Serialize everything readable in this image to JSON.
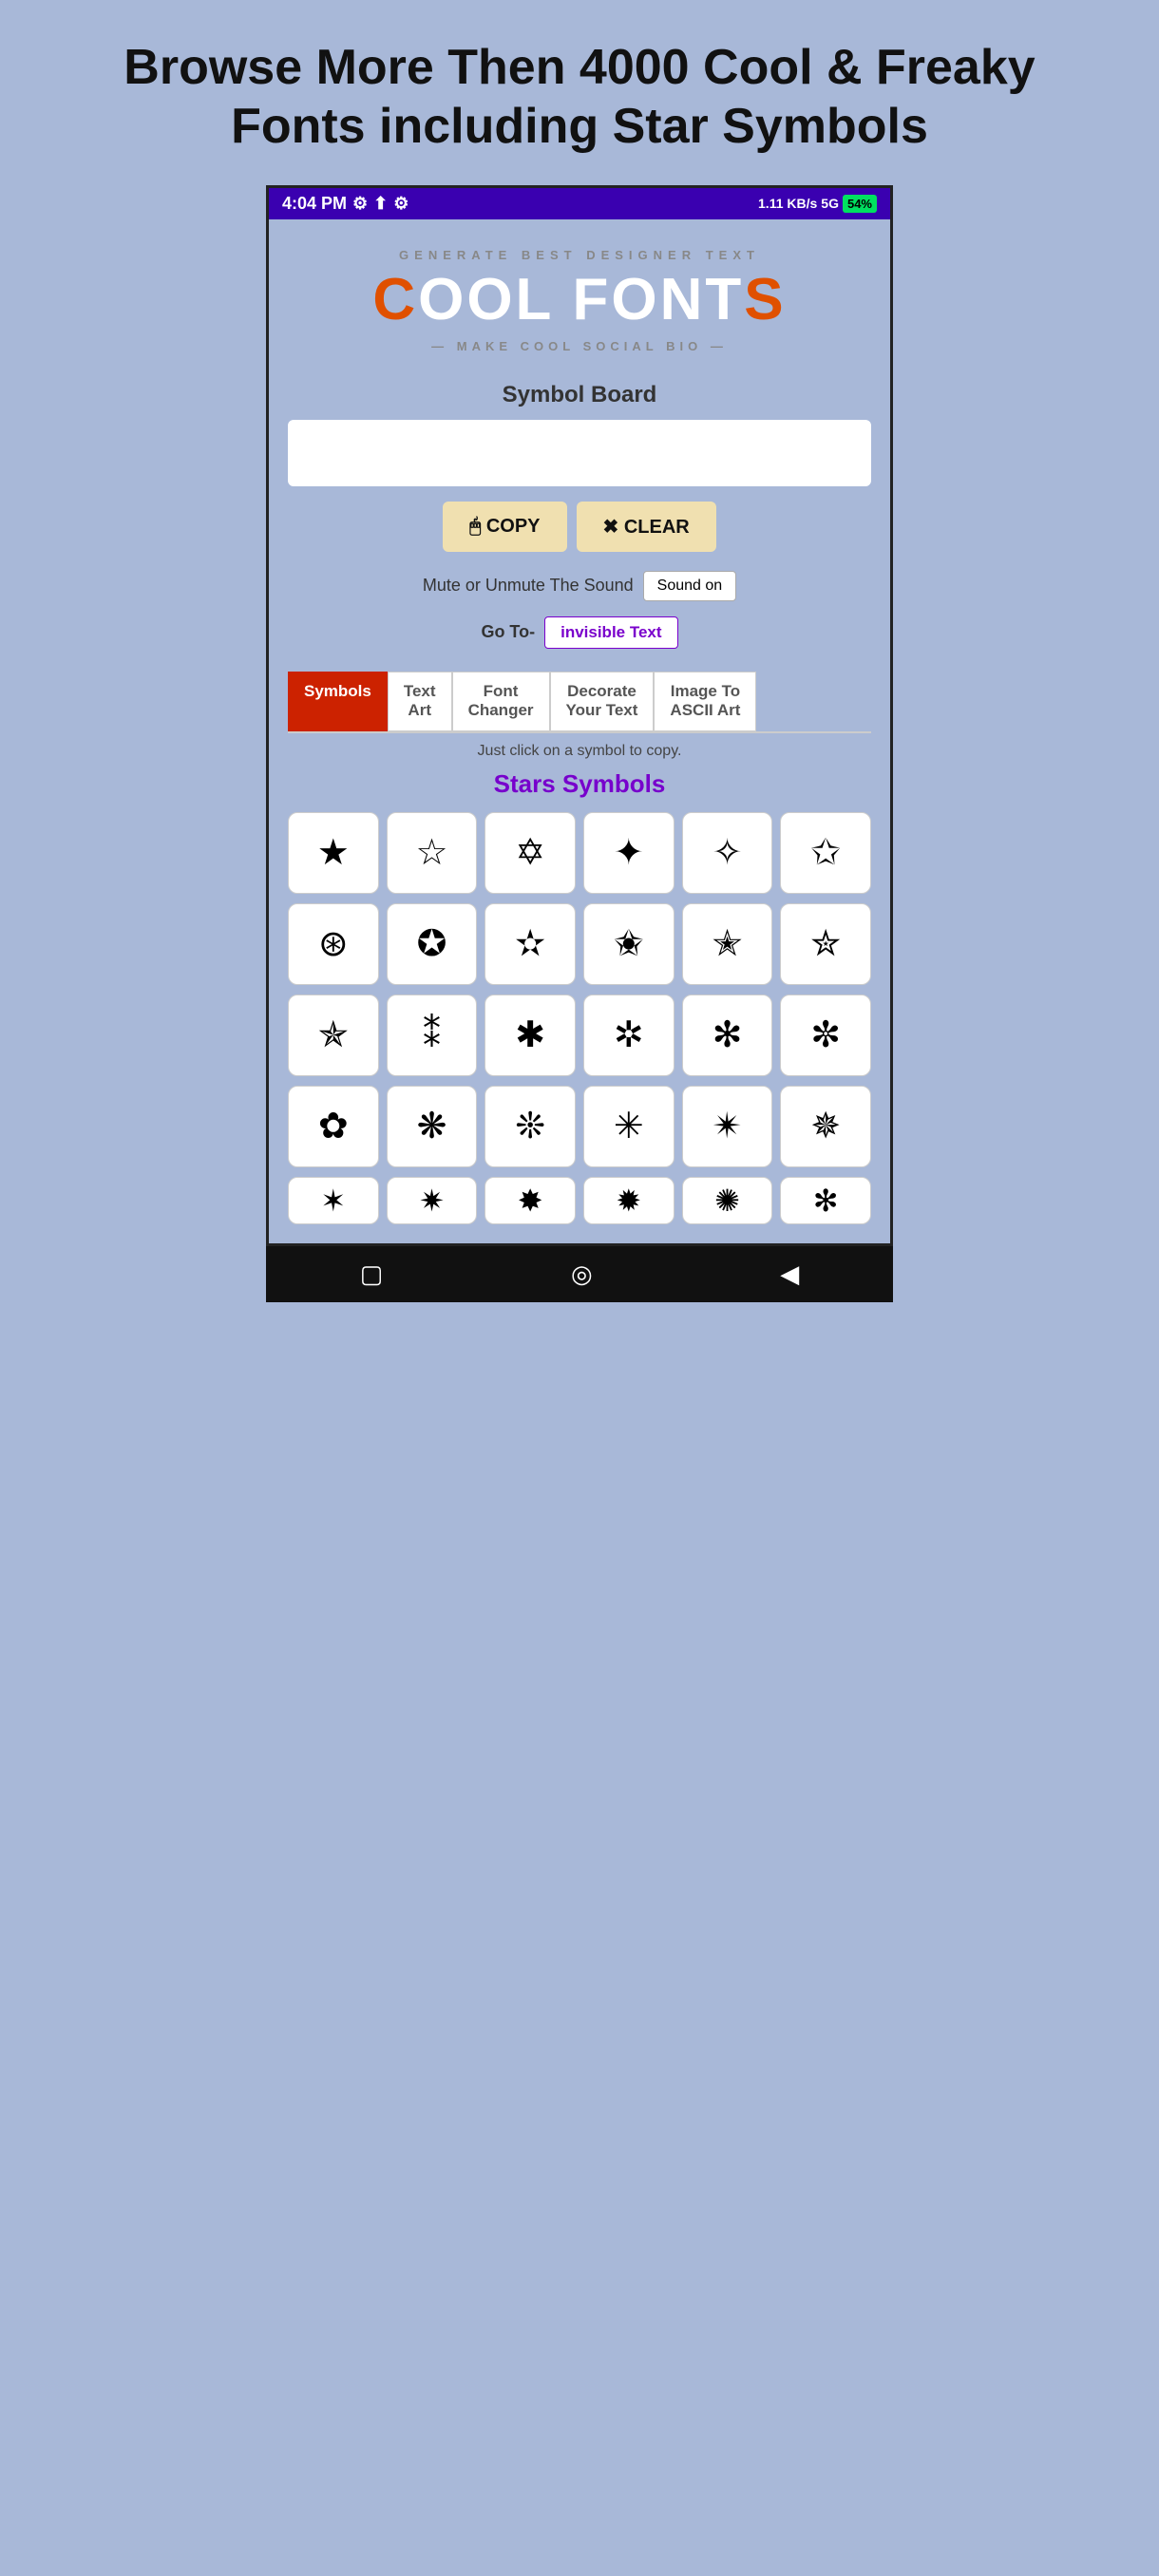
{
  "header": {
    "title": "Browse More Then 4000 Cool & Freaky Fonts including Star Symbols"
  },
  "statusBar": {
    "time": "4:04 PM",
    "network": "1.11 KB/s",
    "battery": "54%"
  },
  "appBanner": {
    "subtitle": "GENERATE BEST DESIGNER TEXT",
    "mainTitle": "COOL FONTS",
    "tagline": "— MAKE COOL SOCIAL BIO —"
  },
  "symbolBoard": {
    "sectionTitle": "Symbol Board",
    "inputPlaceholder": "",
    "copyBtn": "🖱 COPY",
    "clearBtn": "✖ CLEAR"
  },
  "sound": {
    "label": "Mute or Unmute The Sound",
    "btn": "Sound on"
  },
  "goto": {
    "label": "Go To-",
    "btn": "invisible Text"
  },
  "tabs": [
    {
      "id": "symbols",
      "label": "Symbols",
      "active": true
    },
    {
      "id": "text-art",
      "label": "Text Art",
      "active": false
    },
    {
      "id": "font-changer",
      "label": "Font Changer",
      "active": false
    },
    {
      "id": "decorate",
      "label": "Decorate Your Text",
      "active": false
    },
    {
      "id": "image-ascii",
      "label": "Image To ASCII Art",
      "active": false
    }
  ],
  "clickHint": "Just click on a symbol to copy.",
  "starsTitle": "Stars Symbols",
  "symbols": {
    "row1": [
      "★",
      "☆",
      "✡",
      "✦",
      "✧",
      "✩"
    ],
    "row2": [
      "⊛",
      "✪",
      "✫",
      "✬",
      "✭",
      "✮"
    ],
    "row3": [
      "✯",
      "⁑",
      "✱",
      "✲",
      "✻",
      "✼"
    ],
    "row4": [
      "✿",
      "❋",
      "❊",
      "✳",
      "✴",
      "✵"
    ],
    "row5partial": [
      "",
      "",
      "",
      "",
      "",
      ""
    ]
  },
  "navBar": {
    "square": "▢",
    "circle": "◎",
    "back": "◀"
  }
}
